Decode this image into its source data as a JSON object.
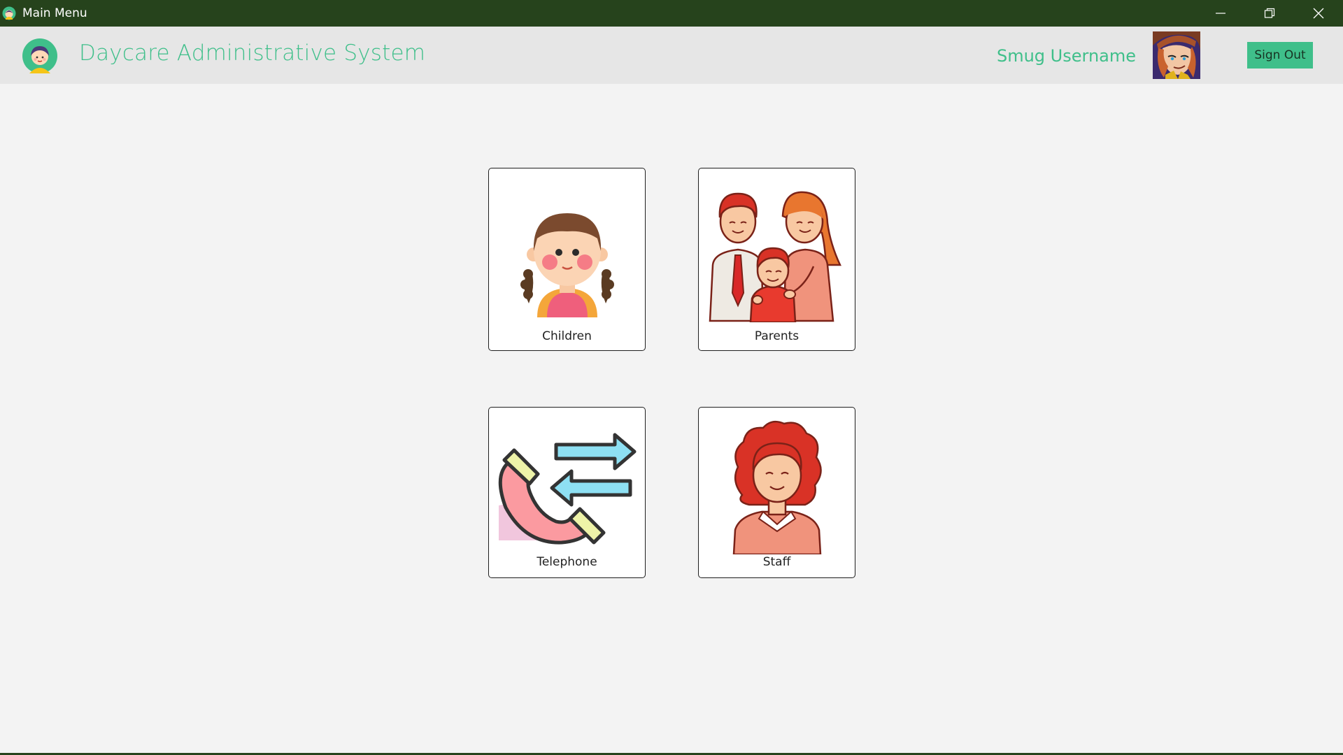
{
  "window": {
    "title": "Main Menu",
    "controls": [
      "minimize-icon",
      "restore-icon",
      "close-icon"
    ]
  },
  "header": {
    "app_title": "Daycare Administrative System",
    "username": "Smug Username",
    "signout_label": "Sign Out"
  },
  "menu": {
    "tiles": [
      {
        "label": "Children",
        "icon": "child-icon"
      },
      {
        "label": "Parents",
        "icon": "family-icon"
      },
      {
        "label": "Telephone",
        "icon": "telephone-icon"
      },
      {
        "label": "Staff",
        "icon": "staff-icon"
      }
    ]
  },
  "colors": {
    "titlebar": "#26431c",
    "accent": "#3fbf8a",
    "background": "#f3f3f3",
    "header": "#e6e6e6"
  }
}
